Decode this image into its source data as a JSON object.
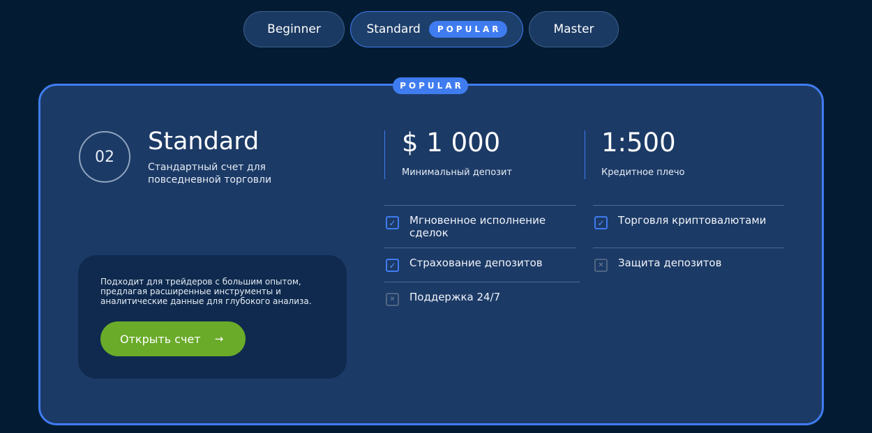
{
  "tabs": [
    {
      "label": "Beginner"
    },
    {
      "label": "Standard",
      "badge": "POPULAR"
    },
    {
      "label": "Master"
    }
  ],
  "card": {
    "badge": "POPULAR",
    "number": "02",
    "title": "Standard",
    "description": "Стандартный счет для повседневной торговли",
    "min_deposit": {
      "value": "$ 1 000",
      "label": "Минимальный депозит"
    },
    "leverage": {
      "value": "1:500",
      "label": "Кредитное плечо"
    },
    "features": [
      {
        "label": "Мгновенное исполнение сделок",
        "included": true
      },
      {
        "label": "Торговля криптовалютами",
        "included": true
      },
      {
        "label": "Страхование депозитов",
        "included": true
      },
      {
        "label": "Защита депозитов",
        "included": false
      },
      {
        "label": "Поддержка 24/7",
        "included": false
      }
    ],
    "cta": {
      "text": "Подходит для трейдеров с большим опытом, предлагая расширенные инструменты и аналитические данные для глубокого анализа.",
      "button_label": "Открыть счет",
      "button_arrow": "→"
    }
  },
  "icons": {
    "check": "✓",
    "cross": "✕"
  },
  "colors": {
    "background": "#041c33",
    "card": "#1c3a66",
    "accent": "#3f7cf0",
    "cta": "#6aab2a"
  }
}
